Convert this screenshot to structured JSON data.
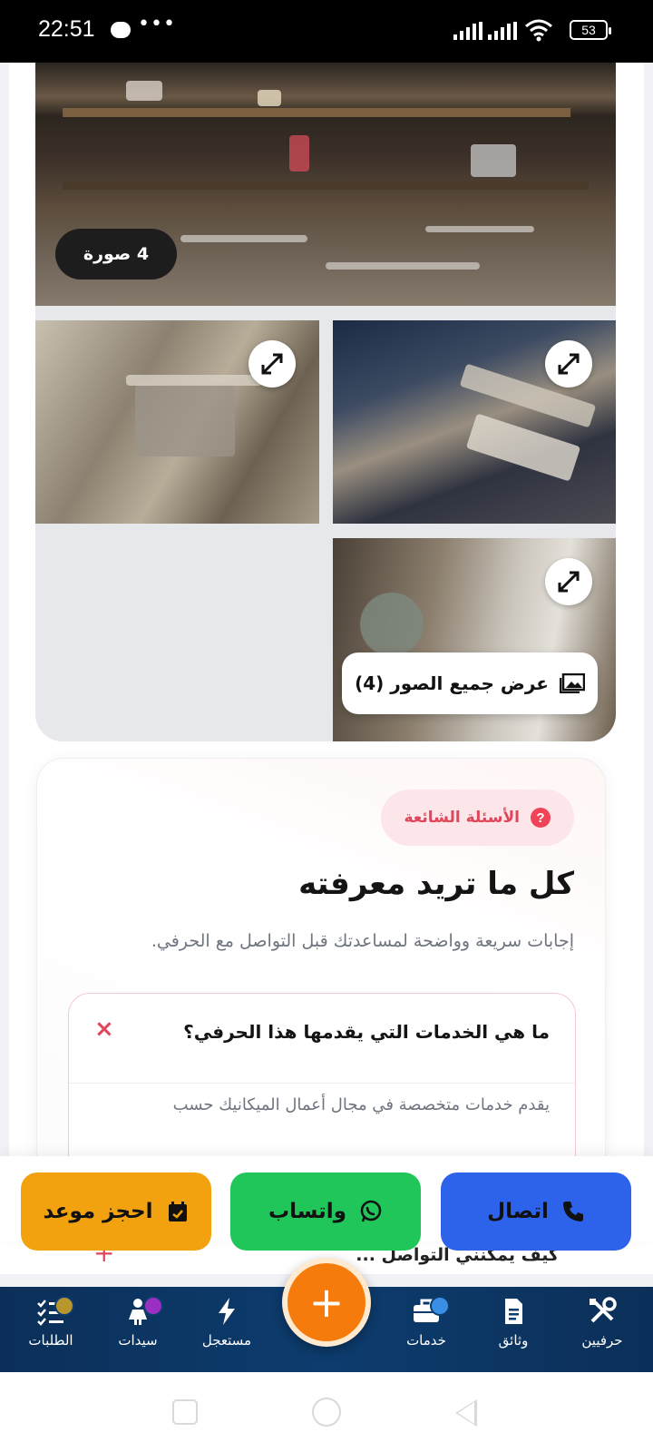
{
  "status_bar": {
    "time": "22:51",
    "more": "•••",
    "battery": "53"
  },
  "gallery": {
    "photo_count_badge": "4 صورة",
    "view_all_label": "عرض جميع الصور (4)"
  },
  "faq": {
    "badge_label": "الأسئلة الشائعة",
    "badge_icon": "?",
    "title": "كل ما تريد معرفته",
    "subtitle": "إجابات سريعة وواضحة لمساعدتك قبل التواصل مع الحرفي.",
    "items": [
      {
        "question": "ما هي الخدمات التي يقدمها هذا الحرفي؟",
        "answer": "يقدم خدمات متخصصة في مجال أعمال الميكانيك حسب",
        "toggle": "×",
        "expanded": true
      },
      {
        "question": "كيف يمكنني التواصل ...",
        "toggle": "+",
        "expanded": false
      }
    ]
  },
  "actions": {
    "call_label": "اتصال",
    "whatsapp_label": "واتساب",
    "book_label": "احجز موعد"
  },
  "bottom_nav": {
    "items": [
      {
        "label": "حرفيين",
        "icon": "tools-icon"
      },
      {
        "label": "وثائق",
        "icon": "document-icon"
      },
      {
        "label": "خدمات",
        "icon": "briefcase-icon"
      },
      {
        "label": "مستعجل",
        "icon": "lightning-icon"
      },
      {
        "label": "سيدات",
        "icon": "woman-icon"
      },
      {
        "label": "الطلبات",
        "icon": "checklist-icon"
      }
    ],
    "fab_label": "+"
  },
  "colors": {
    "call": "#2d63eb",
    "whatsapp": "#21c65a",
    "book": "#f2a20e",
    "nav_bg": "#0d3c6e",
    "fab": "#f57c0c",
    "faq_accent": "#e04559"
  }
}
